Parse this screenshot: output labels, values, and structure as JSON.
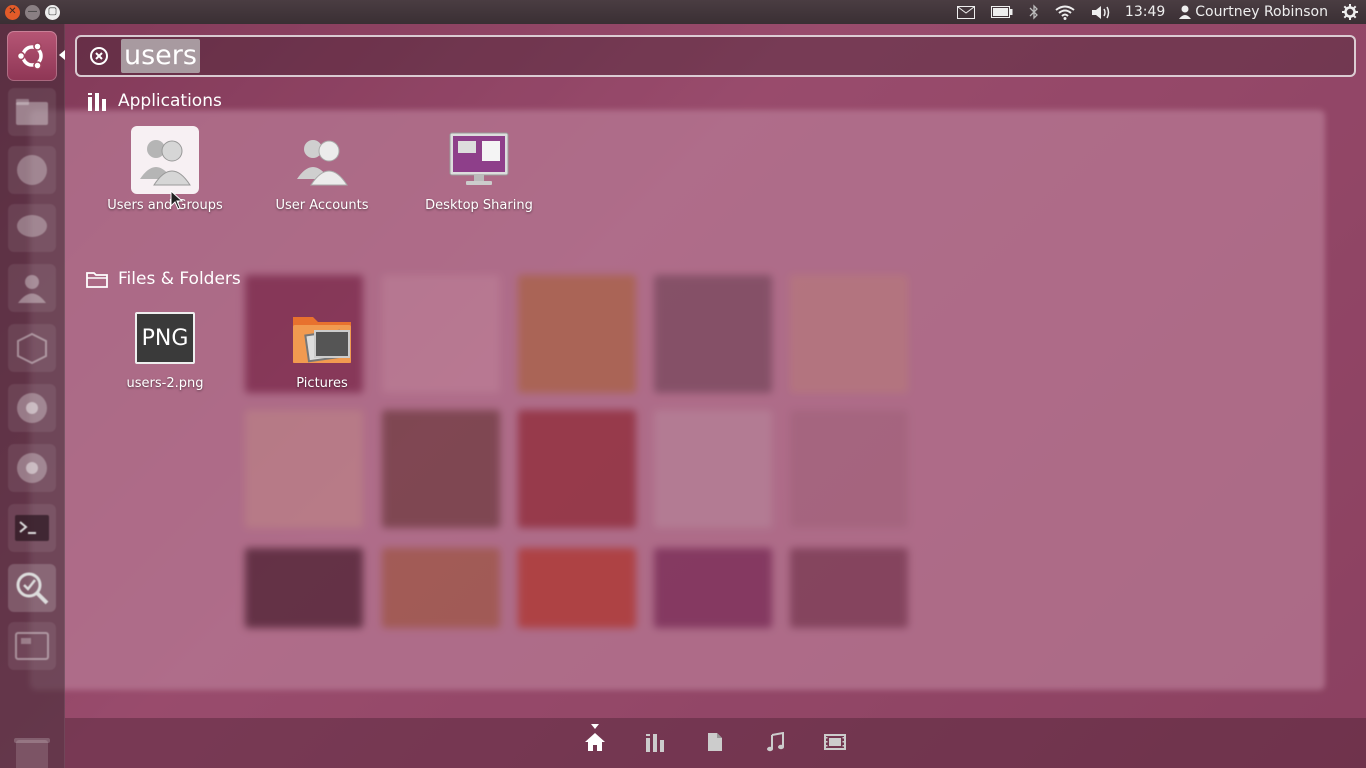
{
  "top_panel": {
    "clock": "13:49",
    "user_name": "Courtney Robinson",
    "icons": [
      "mail-icon",
      "battery-icon",
      "bluetooth-icon",
      "wifi-icon",
      "volume-icon",
      "user-icon",
      "settings-gear-icon"
    ]
  },
  "search": {
    "query": "users"
  },
  "categories": [
    {
      "title": "Applications",
      "icon": "applications-icon",
      "results": [
        {
          "label": "Users and Groups",
          "icon": "users-groups-icon",
          "selected": true
        },
        {
          "label": "User Accounts",
          "icon": "user-accounts-icon",
          "selected": false
        },
        {
          "label": "Desktop Sharing",
          "icon": "desktop-sharing-icon",
          "selected": false
        }
      ]
    },
    {
      "title": "Files & Folders",
      "icon": "folder-icon",
      "results": [
        {
          "label": "users-2.png",
          "icon": "png-file-icon",
          "thumb_text": "PNG",
          "selected": false
        },
        {
          "label": "Pictures",
          "icon": "pictures-folder-icon",
          "selected": false
        }
      ]
    }
  ],
  "launcher": {
    "items": [
      "dash-home-icon",
      "files-icon",
      "firefox-icon",
      "chat-icon",
      "user-accounts-icon",
      "software-center-icon",
      "chrome-icon",
      "chrome-icon",
      "terminal-icon",
      "search-tool-icon",
      "window-icon",
      "trash-icon"
    ]
  },
  "lenses": [
    "home-lens-icon",
    "applications-lens-icon",
    "files-lens-icon",
    "music-lens-icon",
    "video-lens-icon"
  ],
  "colors": {
    "dash_tint": "#8e4a68",
    "launcher_accent": "#b65675",
    "close_button": "#e25b29"
  }
}
